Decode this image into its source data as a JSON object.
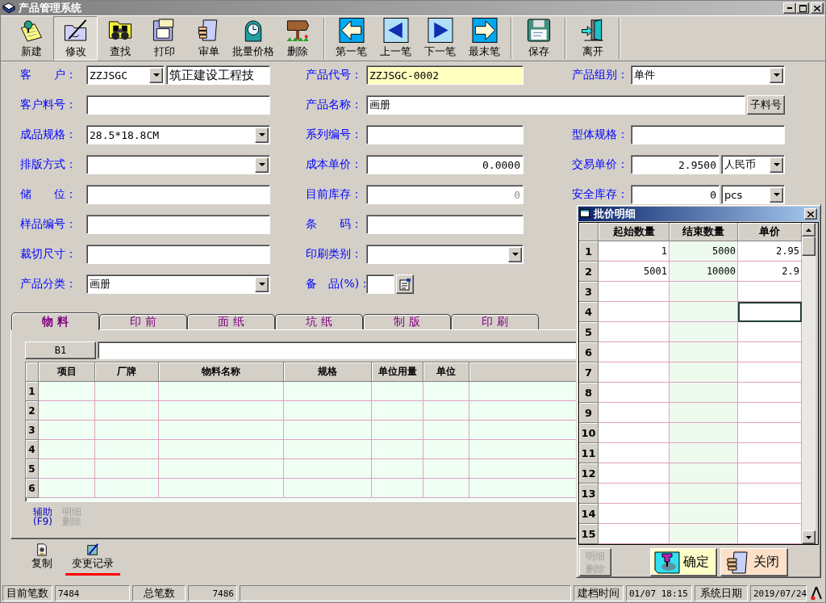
{
  "window": {
    "title": "产品管理系统"
  },
  "toolbar": [
    {
      "label": "新建",
      "kind": "new",
      "selected": false,
      "separator_after": false
    },
    {
      "label": "修改",
      "kind": "edit",
      "selected": true,
      "separator_after": false
    },
    {
      "label": "查找",
      "kind": "find",
      "selected": false,
      "separator_after": false
    },
    {
      "label": "打印",
      "kind": "print",
      "selected": false,
      "separator_after": false
    },
    {
      "label": "审单",
      "kind": "approve",
      "selected": false,
      "separator_after": false
    },
    {
      "label": "批量价格",
      "kind": "price",
      "selected": false,
      "separator_after": false
    },
    {
      "label": "删除",
      "kind": "delete",
      "selected": false,
      "separator_after": true
    },
    {
      "label": "第一笔",
      "kind": "first",
      "selected": false,
      "separator_after": false
    },
    {
      "label": "上一笔",
      "kind": "previous",
      "selected": false,
      "separator_after": false
    },
    {
      "label": "下一笔",
      "kind": "next",
      "selected": false,
      "separator_after": false
    },
    {
      "label": "最末笔",
      "kind": "last",
      "selected": false,
      "separator_after": true
    },
    {
      "label": "保存",
      "kind": "save",
      "selected": false,
      "separator_after": true
    },
    {
      "label": "离开",
      "kind": "exit",
      "selected": false,
      "separator_after": true
    }
  ],
  "form": {
    "rows": [
      {
        "left": {
          "label": "客　　户：",
          "kind": "customer",
          "value": "ZZJSGC",
          "detail": "筑正建设工程技",
          "highlighted": false,
          "readonly": false
        },
        "middle": {
          "label": "产品代号：",
          "kind": "text",
          "value": "ZZJSGC-0002",
          "highlighted": true,
          "readonly": false
        },
        "right": {
          "label": "产品组别：",
          "kind": "combo",
          "value": "单件",
          "highlighted": false,
          "readonly": false
        }
      },
      {
        "left": {
          "label": "客户料号：",
          "kind": "text",
          "highlighted": false
        },
        "middle": {
          "label": "产品名称：",
          "kind": "text_button",
          "value": "画册",
          "button": "子料号",
          "highlighted": false,
          "readonly": false
        }
      },
      {
        "left": {
          "label": "成品规格：",
          "kind": "combo",
          "value": "28.5*18.8CM",
          "highlighted": false,
          "readonly": false
        },
        "middle": {
          "label": "系列编号：",
          "kind": "text",
          "highlighted": false
        },
        "right": {
          "label": "型体规格：",
          "kind": "text",
          "highlighted": false
        }
      },
      {
        "left": {
          "label": "排版方式：",
          "kind": "combo",
          "highlighted": false
        },
        "middle": {
          "label": "成本单价：",
          "kind": "number",
          "value": "0.0000",
          "highlighted": false,
          "readonly": false
        },
        "right": {
          "label": "交易单价：",
          "kind": "amount_unit",
          "value": "2.9500",
          "unit": "人民币",
          "highlighted": false,
          "readonly": false
        }
      },
      {
        "left": {
          "label": "储　　位：",
          "kind": "text",
          "highlighted": false
        },
        "middle": {
          "label": "目前库存：",
          "kind": "number",
          "value": "0",
          "highlighted": false,
          "readonly": true
        },
        "right": {
          "label": "安全库存：",
          "kind": "amount_unit",
          "value": "0",
          "unit": "pcs",
          "highlighted": false,
          "readonly": false
        }
      },
      {
        "left": {
          "label": "样品编号：",
          "kind": "text",
          "highlighted": false
        },
        "middle": {
          "label": "条　　码：",
          "kind": "text",
          "highlighted": false
        }
      },
      {
        "left": {
          "label": "裁切尺寸：",
          "kind": "text",
          "highlighted": false
        },
        "middle": {
          "label": "印刷类别：",
          "kind": "combo",
          "highlighted": false
        }
      },
      {
        "left": {
          "label": "产品分类：",
          "kind": "combo",
          "value": "画册",
          "highlighted": false,
          "readonly": false
        },
        "middle": {
          "label": "备　品(%)：",
          "kind": "picker",
          "highlighted": false
        }
      }
    ]
  },
  "tabs": [
    {
      "label": "物 料",
      "selected": true
    },
    {
      "label": "印 前",
      "selected": false
    },
    {
      "label": "面 纸",
      "selected": false
    },
    {
      "label": "坑 纸",
      "selected": false
    },
    {
      "label": "制 版",
      "selected": false
    },
    {
      "label": "印 刷",
      "selected": false
    }
  ],
  "materials": {
    "cell_ref": "B1",
    "columns": [
      "项目",
      "厂牌",
      "物料名称",
      "规格",
      "单位用量",
      "单位"
    ],
    "rows": [
      "1",
      "2",
      "3",
      "4",
      "5",
      "6"
    ],
    "buttons": [
      {
        "lines": [
          "辅助",
          "(F9)"
        ],
        "disabled": false
      },
      {
        "lines": [
          "明细",
          "删除"
        ],
        "disabled": true
      }
    ]
  },
  "actions": [
    {
      "label": "复制",
      "kind": "copy",
      "selected": false
    },
    {
      "label": "变更记录",
      "kind": "history",
      "selected": true
    }
  ],
  "status_bar": {
    "left": [
      {
        "kind": "label",
        "text": "目前笔数"
      },
      {
        "kind": "value",
        "text": "7484"
      },
      {
        "kind": "label",
        "text": "总笔数"
      },
      {
        "kind": "value",
        "text": "7486"
      }
    ],
    "right": [
      {
        "kind": "label",
        "text": "建档时间"
      },
      {
        "kind": "value",
        "text": "01/07 18:15"
      },
      {
        "kind": "label",
        "text": "系统日期"
      },
      {
        "kind": "value",
        "text": "2019/07/24"
      }
    ]
  },
  "dialog": {
    "title": "批价明细",
    "columns": [
      "起始数量",
      "结束数量",
      "单价"
    ],
    "rows": [
      {
        "number": "1",
        "cells": [
          {
            "value": "1",
            "selected": false
          },
          {
            "value": "5000",
            "selected": false
          },
          {
            "value": "2.95",
            "selected": false
          }
        ]
      },
      {
        "number": "2",
        "cells": [
          {
            "value": "5001",
            "selected": false
          },
          {
            "value": "10000",
            "selected": false
          },
          {
            "value": "2.9",
            "selected": false
          }
        ]
      },
      {
        "number": "3",
        "cells": [
          {
            "selected": false
          },
          {
            "selected": false
          },
          {
            "selected": false
          }
        ]
      },
      {
        "number": "4",
        "cells": [
          {
            "selected": false
          },
          {
            "selected": false
          },
          {
            "selected": true
          }
        ]
      },
      {
        "number": "5",
        "cells": [
          {
            "selected": false
          },
          {
            "selected": false
          },
          {
            "selected": false
          }
        ]
      },
      {
        "number": "6",
        "cells": [
          {
            "selected": false
          },
          {
            "selected": false
          },
          {
            "selected": false
          }
        ]
      },
      {
        "number": "7",
        "cells": [
          {
            "selected": false
          },
          {
            "selected": false
          },
          {
            "selected": false
          }
        ]
      },
      {
        "number": "8",
        "cells": [
          {
            "selected": false
          },
          {
            "selected": false
          },
          {
            "selected": false
          }
        ]
      },
      {
        "number": "9",
        "cells": [
          {
            "selected": false
          },
          {
            "selected": false
          },
          {
            "selected": false
          }
        ]
      },
      {
        "number": "10",
        "cells": [
          {
            "selected": false
          },
          {
            "selected": false
          },
          {
            "selected": false
          }
        ]
      },
      {
        "number": "11",
        "cells": [
          {
            "selected": false
          },
          {
            "selected": false
          },
          {
            "selected": false
          }
        ]
      },
      {
        "number": "12",
        "cells": [
          {
            "selected": false
          },
          {
            "selected": false
          },
          {
            "selected": false
          }
        ]
      },
      {
        "number": "13",
        "cells": [
          {
            "selected": false
          },
          {
            "selected": false
          },
          {
            "selected": false
          }
        ]
      },
      {
        "number": "14",
        "cells": [
          {
            "selected": false
          },
          {
            "selected": false
          },
          {
            "selected": false
          }
        ]
      },
      {
        "number": "15",
        "cells": [
          {
            "selected": false
          },
          {
            "selected": false
          },
          {
            "selected": false
          }
        ]
      }
    ],
    "buttons": [
      {
        "lines": [
          "明细",
          "删除"
        ],
        "kind": "delete",
        "disabled": true
      },
      {
        "lines": [
          "确定"
        ],
        "kind": "confirm",
        "disabled": false
      },
      {
        "lines": [
          "关闭"
        ],
        "kind": "close",
        "disabled": false
      }
    ]
  }
}
